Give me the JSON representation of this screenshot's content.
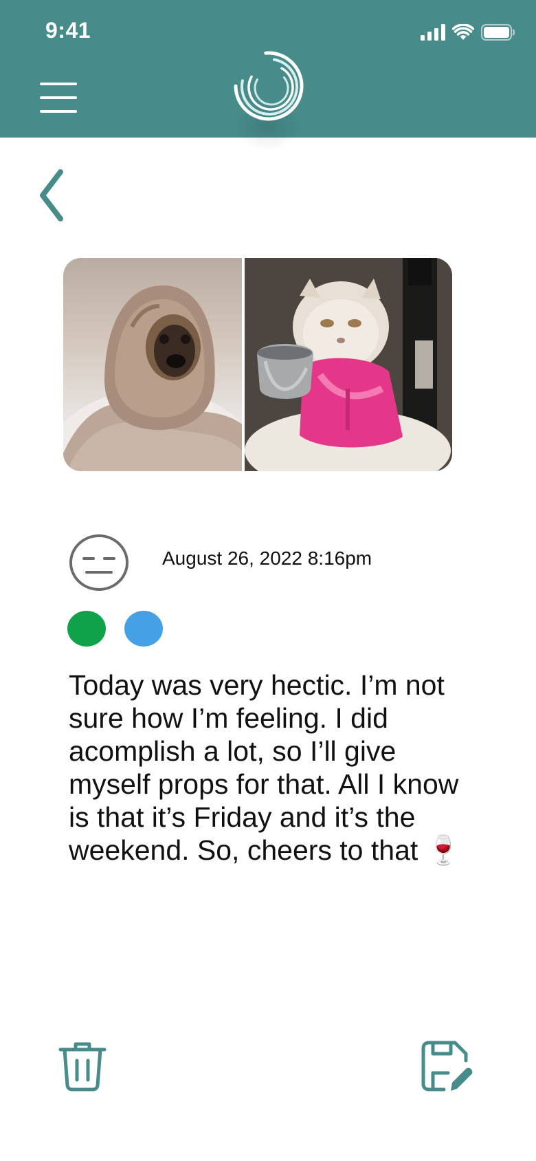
{
  "status_bar": {
    "time": "9:41"
  },
  "header": {
    "menu_icon": "hamburger-menu-icon",
    "logo_icon": "app-logo-swirl-icon",
    "background": "#478b8b"
  },
  "nav": {
    "back_icon": "chevron-left-icon"
  },
  "photos": [
    {
      "subject": "pug-in-blanket"
    },
    {
      "subject": "cat-in-pink-robe-with-wine"
    }
  ],
  "entry": {
    "mood_icon": "neutral-face-icon",
    "date": "August 26, 2022 8:16pm",
    "tags": [
      {
        "color": "#0fa24b"
      },
      {
        "color": "#45a0e6"
      }
    ],
    "text": "Today was very hectic. I’m not sure how I’m feeling. I did acomplish a lot, so I’ll give myself props for that. All I know is that it’s Friday and it’s the weekend. So, cheers to that 🍷"
  },
  "actions": {
    "delete_icon": "trash-icon",
    "save_icon": "save-edit-icon"
  },
  "colors": {
    "accent": "#478b8b",
    "mood_gray": "#6b6b6b"
  }
}
